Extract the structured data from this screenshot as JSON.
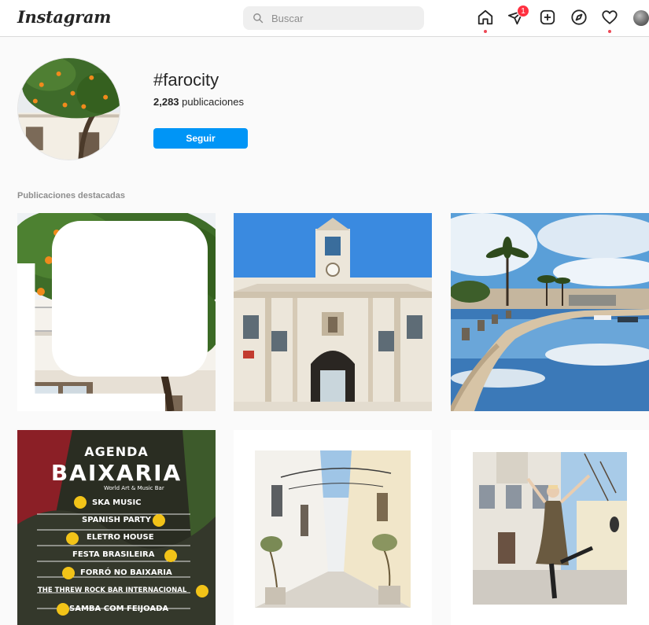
{
  "header": {
    "logo": "Instagram",
    "search_placeholder": "Buscar",
    "icons": [
      "home-icon",
      "direct-message-icon",
      "new-post-icon",
      "explore-icon",
      "activity-heart-icon",
      "profile-avatar-icon"
    ],
    "messages_badge": "1"
  },
  "profile": {
    "hashtag": "#farocity",
    "posts_count": "2,283",
    "posts_label": "publicaciones",
    "follow_label": "Seguir"
  },
  "section": {
    "title": "Publicaciones destacadas"
  },
  "posts": [
    {
      "id": "post-orange-tree",
      "multi": true
    },
    {
      "id": "post-arco-da-vila",
      "multi": false
    },
    {
      "id": "post-marina-palms",
      "multi": false
    },
    {
      "id": "post-baixaria-agenda",
      "multi": false,
      "poster": {
        "title": "AGENDA",
        "brand": "BAIXARIA",
        "tagline": "World Art & Music Bar",
        "events": [
          "SKA MUSIC",
          "SPANISH PARTY",
          "ELETRO HOUSE",
          "FESTA BRASILEIRA",
          "FORRÓ NO BAIXARIA",
          "THE THREW ROCK BAR INTERNACIONAL",
          "SAMBA COM FEIJOADA"
        ]
      }
    },
    {
      "id": "post-narrow-street",
      "multi": false
    },
    {
      "id": "post-woman-posing",
      "multi": false
    }
  ],
  "colors": {
    "accent": "#0095f6",
    "notification": "#ff3040",
    "dot": "#ed4956"
  }
}
